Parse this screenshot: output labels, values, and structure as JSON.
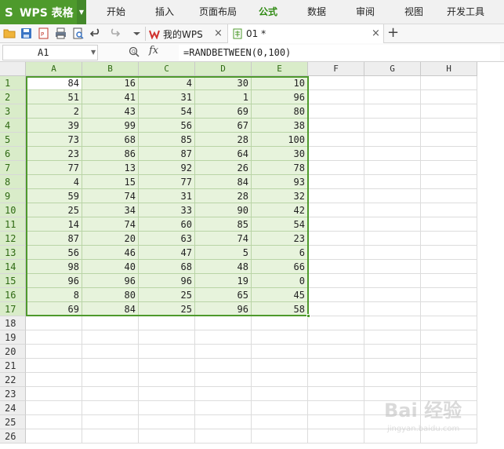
{
  "app": {
    "name": "WPS 表格",
    "logo": "S"
  },
  "menu": [
    "开始",
    "插入",
    "页面布局",
    "公式",
    "数据",
    "审阅",
    "视图",
    "开发工具"
  ],
  "menu_active": "公式",
  "toolbar": {
    "icons": [
      "open-folder-icon",
      "save-icon",
      "export-pdf-icon",
      "print-icon",
      "print-preview-icon",
      "undo-icon",
      "redo-icon",
      "more-dropdown-icon"
    ]
  },
  "tabs": [
    {
      "label": "我的WPS",
      "icon": "wps-home-icon",
      "close": "×"
    },
    {
      "label": "01 *",
      "icon": "spreadsheet-file-icon",
      "close": "×"
    }
  ],
  "add_tab": "+",
  "formula_bar": {
    "cell_ref": "A1",
    "fx": "fx",
    "formula": "=RANDBETWEEN(0,100)"
  },
  "grid": {
    "columns": [
      "A",
      "B",
      "C",
      "D",
      "E",
      "F",
      "G",
      "H"
    ],
    "selected_columns": [
      "A",
      "B",
      "C",
      "D",
      "E"
    ],
    "row_count": 26,
    "selected_rows": 17,
    "active_cell": "A1",
    "data": [
      [
        84,
        16,
        4,
        30,
        10
      ],
      [
        51,
        41,
        31,
        1,
        96
      ],
      [
        2,
        43,
        54,
        69,
        80
      ],
      [
        39,
        99,
        56,
        67,
        38
      ],
      [
        73,
        68,
        85,
        28,
        100
      ],
      [
        23,
        86,
        87,
        64,
        30
      ],
      [
        77,
        13,
        92,
        26,
        78
      ],
      [
        4,
        15,
        77,
        84,
        93
      ],
      [
        59,
        74,
        31,
        28,
        32
      ],
      [
        25,
        34,
        33,
        90,
        42
      ],
      [
        14,
        74,
        60,
        85,
        54
      ],
      [
        87,
        20,
        63,
        74,
        23
      ],
      [
        56,
        46,
        47,
        5,
        6
      ],
      [
        98,
        40,
        68,
        48,
        66
      ],
      [
        96,
        96,
        96,
        19,
        0
      ],
      [
        8,
        80,
        25,
        65,
        45
      ],
      [
        69,
        84,
        25,
        96,
        58
      ]
    ]
  },
  "colors": {
    "accent": "#4e9a2c",
    "selection_fill": "#e7f3dc",
    "header_selected": "#d9ecc9"
  },
  "watermark": {
    "text": "Bai 经验",
    "sub": "jingyan.baidu.com"
  }
}
